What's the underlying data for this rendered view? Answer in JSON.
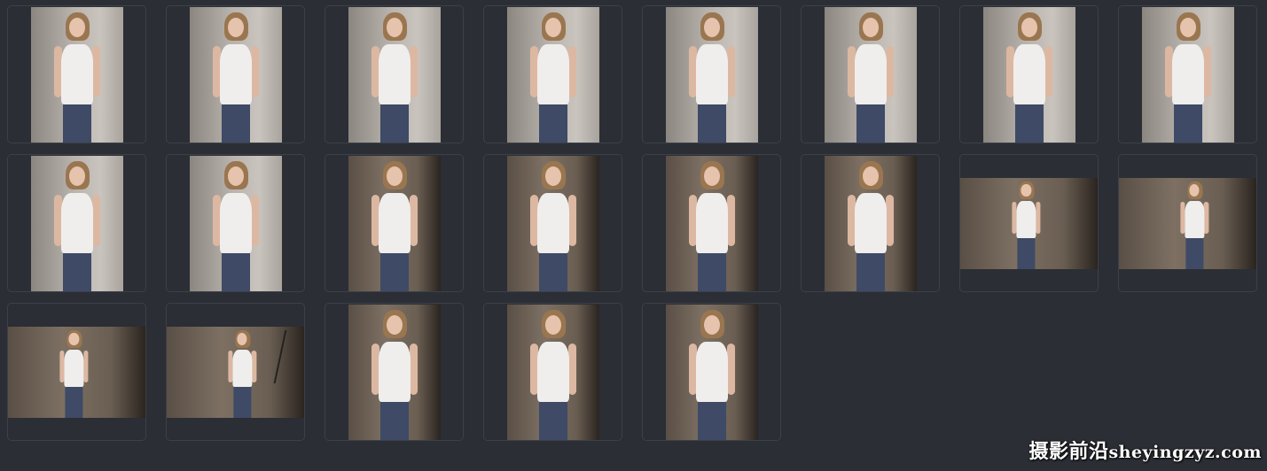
{
  "watermark": {
    "chinese": "摄影前沿",
    "url": "sheyingzyz.com"
  },
  "thumbnails": [
    {
      "orientation": "portrait",
      "tone": "light"
    },
    {
      "orientation": "portrait",
      "tone": "light"
    },
    {
      "orientation": "portrait",
      "tone": "light"
    },
    {
      "orientation": "portrait",
      "tone": "light"
    },
    {
      "orientation": "portrait",
      "tone": "light"
    },
    {
      "orientation": "portrait",
      "tone": "light"
    },
    {
      "orientation": "portrait",
      "tone": "light"
    },
    {
      "orientation": "portrait",
      "tone": "light"
    },
    {
      "orientation": "portrait",
      "tone": "light"
    },
    {
      "orientation": "portrait",
      "tone": "light"
    },
    {
      "orientation": "portrait",
      "tone": "dark"
    },
    {
      "orientation": "portrait",
      "tone": "dark"
    },
    {
      "orientation": "portrait",
      "tone": "dark"
    },
    {
      "orientation": "portrait",
      "tone": "dark"
    },
    {
      "orientation": "landscape",
      "tone": "dark"
    },
    {
      "orientation": "landscape",
      "tone": "dark"
    },
    {
      "orientation": "landscape",
      "tone": "dark"
    },
    {
      "orientation": "landscape",
      "tone": "dark"
    },
    {
      "orientation": "portrait",
      "tone": "dark"
    },
    {
      "orientation": "portrait",
      "tone": "dark"
    },
    {
      "orientation": "portrait",
      "tone": "dark"
    }
  ]
}
